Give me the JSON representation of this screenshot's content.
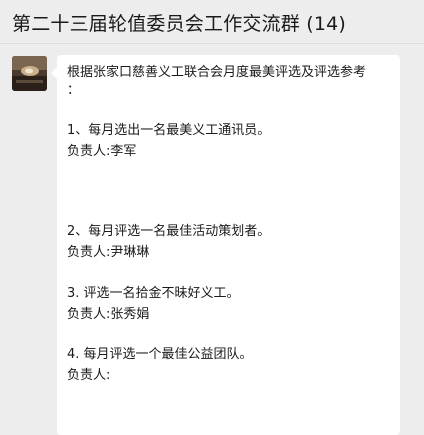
{
  "header": {
    "title": "第二十三届轮值委员会工作交流群 (14)"
  },
  "message": {
    "avatar_icon": "avatar-photo-icon",
    "lines": [
      "根据张家口慈善义工联合会月度最美评选及评选参考",
      "：",
      "1、每月选出一名最美义工通讯员。",
      "负责人:李军",
      "2、每月评选一名最佳活动策划者。",
      "负责人:尹琳琳",
      "3. 评选一名拾金不昧好义工。",
      "负责人:张秀娟",
      "4. 每月评选一个最佳公益团队。",
      "负责人:"
    ]
  }
}
